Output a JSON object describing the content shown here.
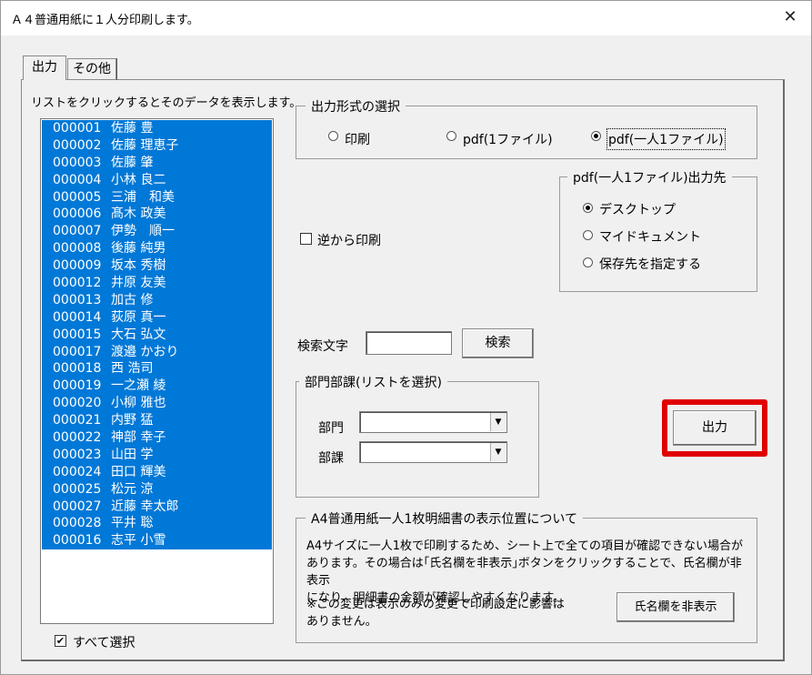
{
  "window": {
    "title": "Ａ４普通用紙に１人分印刷します。",
    "close_glyph": "✕"
  },
  "tabs": [
    {
      "label": "出力",
      "active": true
    },
    {
      "label": "その他",
      "active": false
    }
  ],
  "list": {
    "caption": "リストをクリックするとそのデータを表示します。",
    "items": [
      {
        "code": "000001",
        "name": "佐藤 豊"
      },
      {
        "code": "000002",
        "name": "佐藤 理恵子"
      },
      {
        "code": "000003",
        "name": "佐藤 肇"
      },
      {
        "code": "000004",
        "name": "小林 良二"
      },
      {
        "code": "000005",
        "name": "三浦　和美"
      },
      {
        "code": "000006",
        "name": "髙木 政美"
      },
      {
        "code": "000007",
        "name": "伊勢　順一"
      },
      {
        "code": "000008",
        "name": "後藤 純男"
      },
      {
        "code": "000009",
        "name": "坂本 秀樹"
      },
      {
        "code": "000012",
        "name": "井原 友美"
      },
      {
        "code": "000013",
        "name": "加古 修"
      },
      {
        "code": "000014",
        "name": "荻原 真一"
      },
      {
        "code": "000015",
        "name": "大石 弘文"
      },
      {
        "code": "000017",
        "name": "渡邉 かおり"
      },
      {
        "code": "000018",
        "name": "西 浩司"
      },
      {
        "code": "000019",
        "name": "一之瀬 綾"
      },
      {
        "code": "000020",
        "name": "小柳 雅也"
      },
      {
        "code": "000021",
        "name": "内野 猛"
      },
      {
        "code": "000022",
        "name": "神部 幸子"
      },
      {
        "code": "000023",
        "name": "山田 学"
      },
      {
        "code": "000024",
        "name": "田口 輝美"
      },
      {
        "code": "000025",
        "name": "松元 涼"
      },
      {
        "code": "000027",
        "name": "近藤 幸太郎"
      },
      {
        "code": "000028",
        "name": "平井 聡"
      },
      {
        "code": "000016",
        "name": "志平 小雪"
      }
    ],
    "select_all_label": "すべて選択",
    "select_all_checked": true,
    "selection_color": "#0078d7"
  },
  "output_format": {
    "legend": "出力形式の選択",
    "options": [
      {
        "label": "印刷",
        "checked": false
      },
      {
        "label": "pdf(1ファイル)",
        "checked": false
      },
      {
        "label": "pdf(一人1ファイル)",
        "checked": true
      }
    ]
  },
  "reverse_print": {
    "label": "逆から印刷",
    "checked": false
  },
  "pdf_dest": {
    "legend": "pdf(一人1ファイル)出力先",
    "options": [
      {
        "label": "デスクトップ",
        "checked": true
      },
      {
        "label": "マイドキュメント",
        "checked": false
      },
      {
        "label": "保存先を指定する",
        "checked": false
      }
    ]
  },
  "search": {
    "label": "検索文字",
    "value": "",
    "button_label": "検索"
  },
  "dept": {
    "legend": "部門部課(リストを選択)",
    "dept_label": "部門",
    "dept_value": "",
    "section_label": "部課",
    "section_value": "",
    "arrow_glyph": "▼"
  },
  "output_button": {
    "label": "出力",
    "highlight_color": "#e00000"
  },
  "info": {
    "legend": "A4普通用紙一人1枚明細書の表示位置について",
    "lines": [
      "A4サイズに一人1枚で印刷するため、シート上で全ての項目が確認できない場合が",
      "あります。その場合は｢氏名欄を非表示｣ボタンをクリックすることで、氏名欄が非表示",
      "になり、明細書の金額が確認しやすくなります。"
    ],
    "note_lines": [
      "※この変更は表示のみの変更で印刷設定に影響は",
      "ありません。"
    ],
    "hide_name_button": "氏名欄を非表示"
  }
}
